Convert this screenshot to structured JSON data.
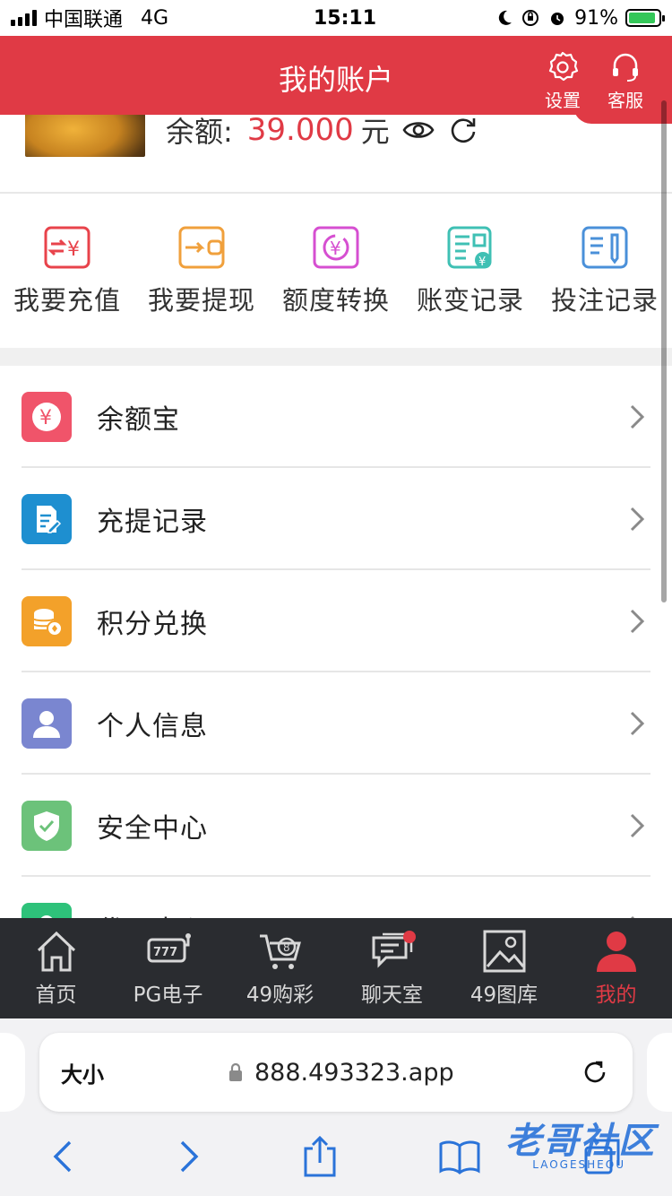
{
  "status_bar": {
    "carrier": "中国联通",
    "network": "4G",
    "time": "15:11",
    "battery": "91%",
    "battery_level": 0.91
  },
  "header": {
    "title": "我的账户",
    "settings_label": "设置",
    "service_label": "客服",
    "color": "#e03a45"
  },
  "profile": {
    "balance_label": "余额:",
    "balance_value": "39.000",
    "currency": "元"
  },
  "actions": [
    {
      "label": "我要充值",
      "icon": "recharge-icon",
      "color": "#e8434b"
    },
    {
      "label": "我要提现",
      "icon": "withdraw-icon",
      "color": "#f0a03c"
    },
    {
      "label": "额度转换",
      "icon": "transfer-icon",
      "color": "#d64fd1"
    },
    {
      "label": "账变记录",
      "icon": "account-record-icon",
      "color": "#3fc0b4"
    },
    {
      "label": "投注记录",
      "icon": "bet-record-icon",
      "color": "#4a90d9"
    }
  ],
  "menu": [
    {
      "label": "余额宝",
      "icon": "yen-icon",
      "color": "#f0546a"
    },
    {
      "label": "充提记录",
      "icon": "document-edit-icon",
      "color": "#1e8fd0"
    },
    {
      "label": "积分兑换",
      "icon": "coins-icon",
      "color": "#f3a12a"
    },
    {
      "label": "个人信息",
      "icon": "user-icon",
      "color": "#7a86d0"
    },
    {
      "label": "安全中心",
      "icon": "shield-check-icon",
      "color": "#6cc27a"
    },
    {
      "label": "代理中心",
      "icon": "agent-icon",
      "color": "#2ec27a"
    }
  ],
  "tabbar": [
    {
      "label": "首页",
      "icon": "home-icon",
      "active": false
    },
    {
      "label": "PG电子",
      "icon": "slot-machine-icon",
      "active": false
    },
    {
      "label": "49购彩",
      "icon": "cart-icon",
      "active": false
    },
    {
      "label": "聊天室",
      "icon": "chat-icon",
      "active": false,
      "badge": true
    },
    {
      "label": "49图库",
      "icon": "image-icon",
      "active": false
    },
    {
      "label": "我的",
      "icon": "person-icon",
      "active": true
    }
  ],
  "browser": {
    "text_size": "大小",
    "url": "888.493323.app"
  },
  "watermark": {
    "title": "老哥社区",
    "subtitle": "LAOGESHEQU"
  }
}
